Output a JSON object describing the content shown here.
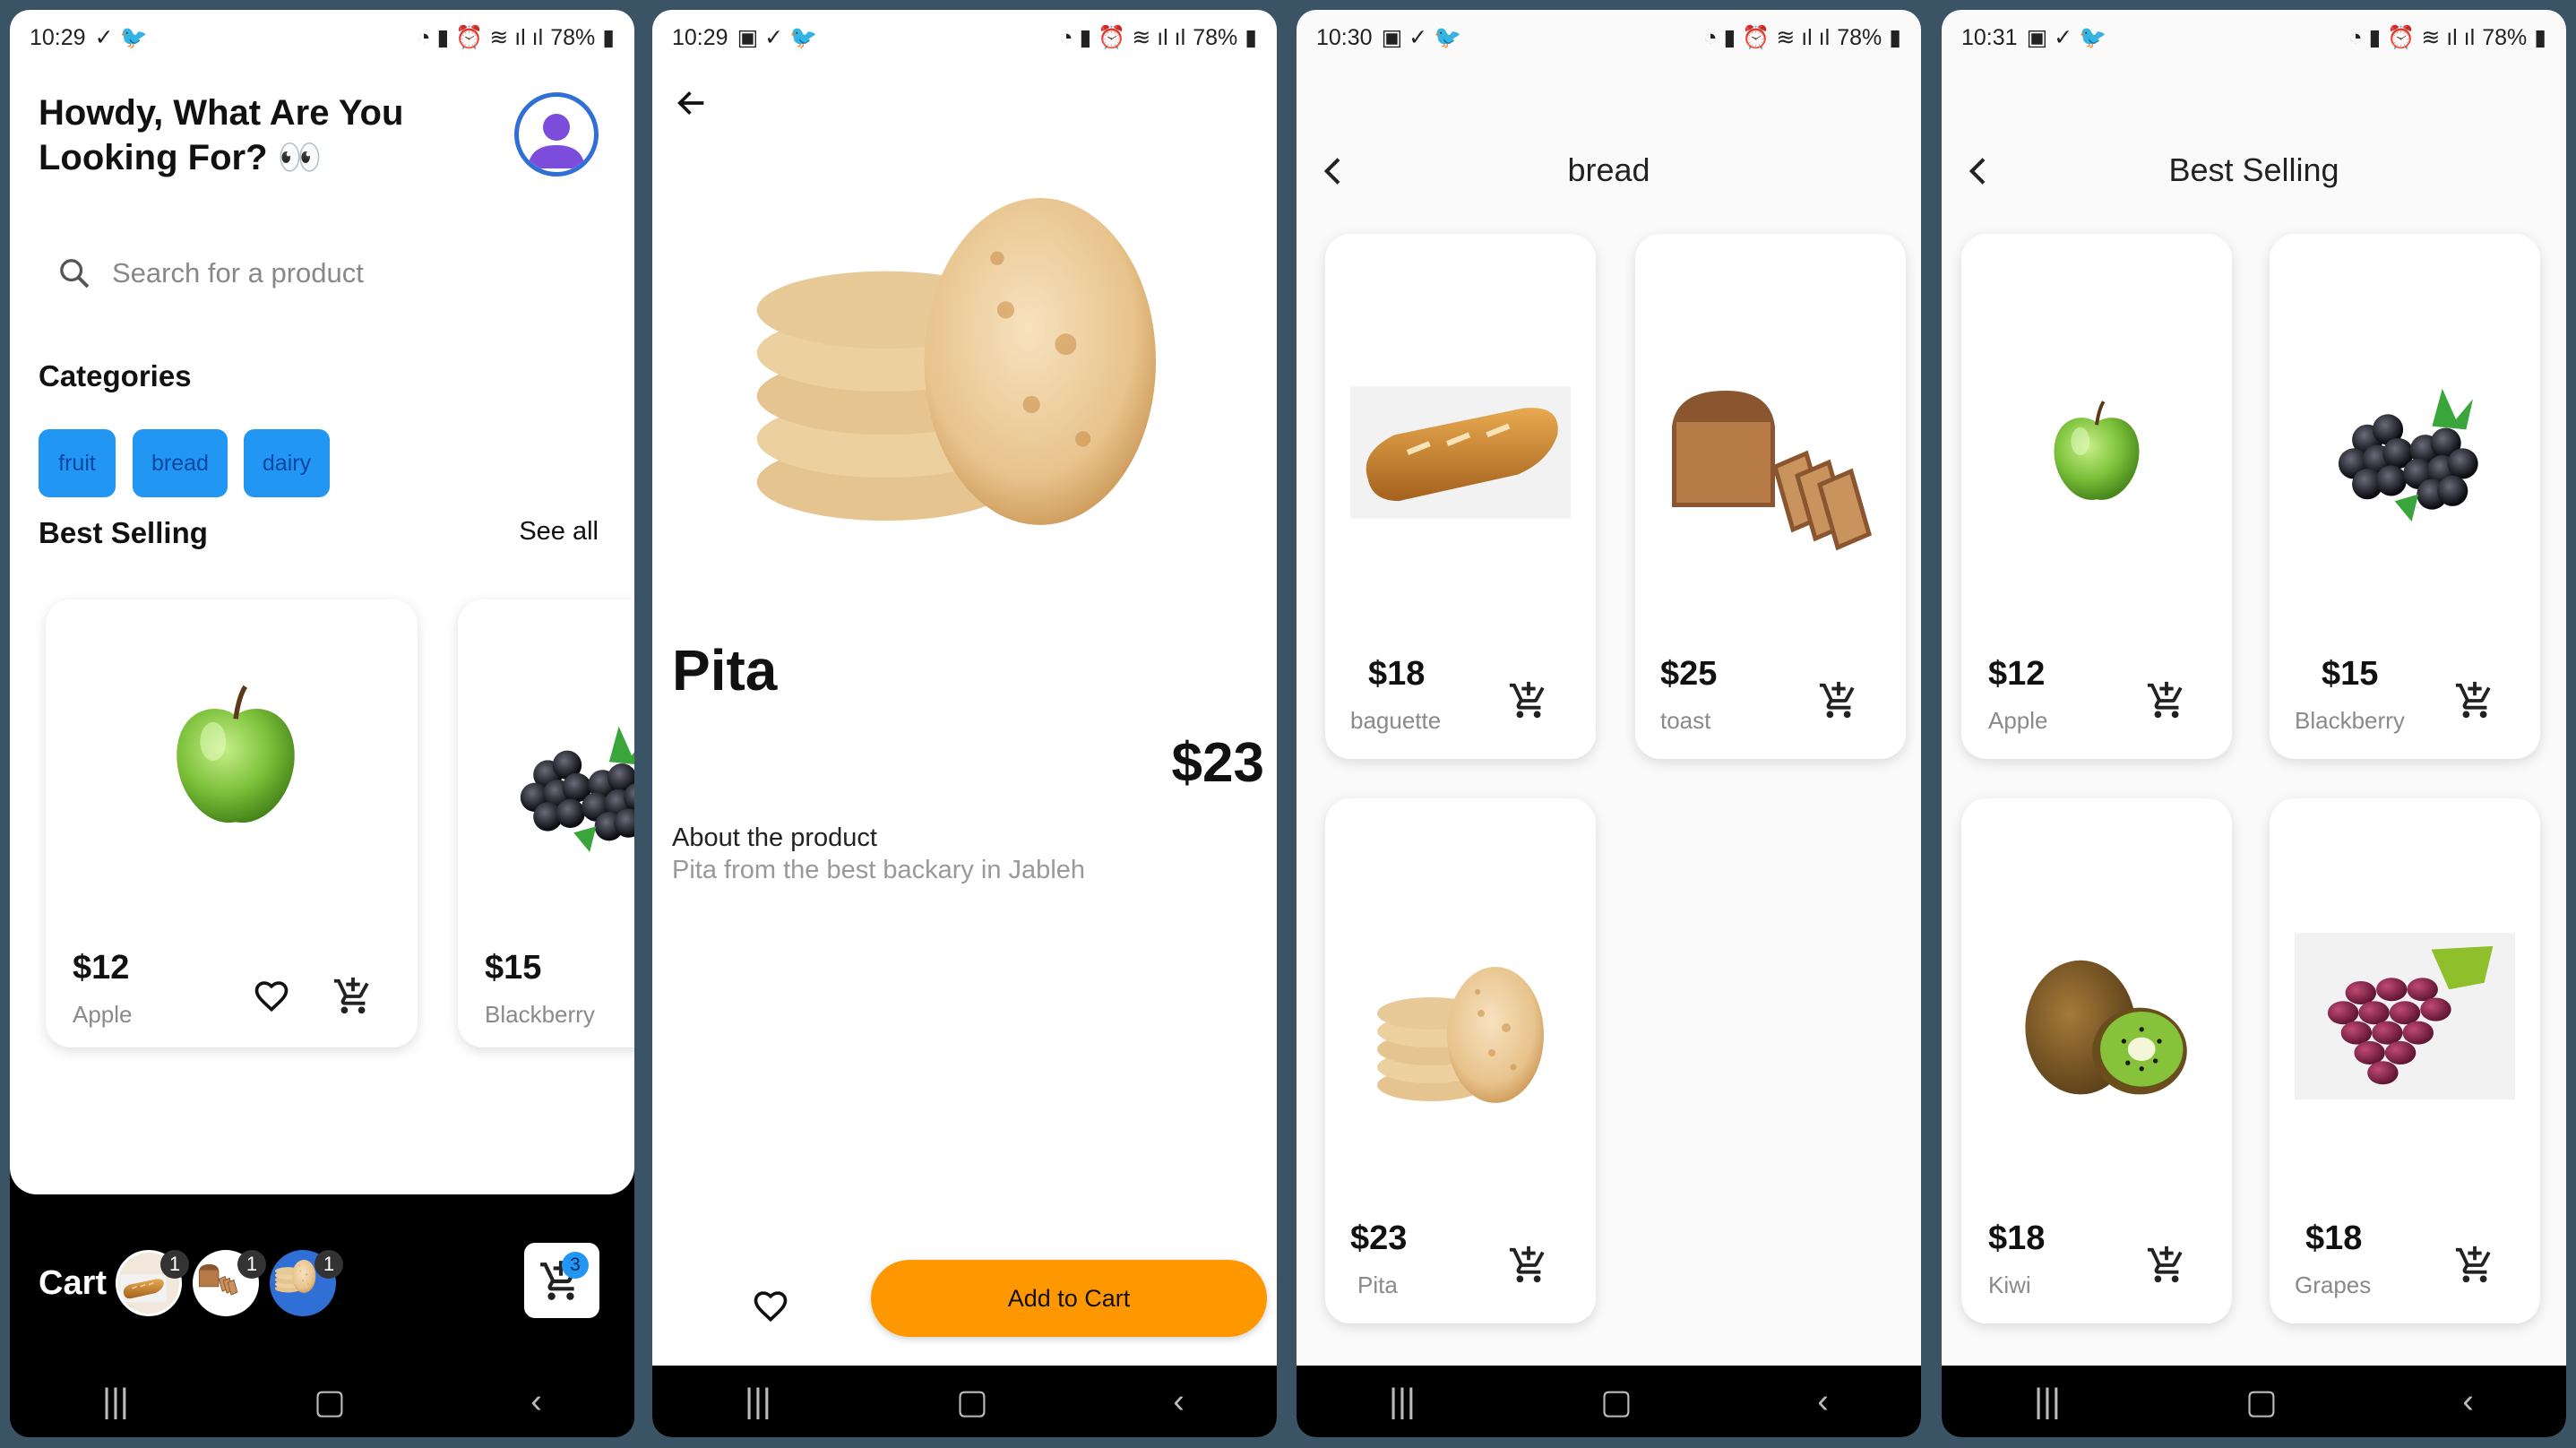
{
  "colors": {
    "accent": "#2196f3",
    "orange": "#ff9800",
    "bg": "#3a5466"
  },
  "status": {
    "battery": "78%",
    "s1_time": "10:29",
    "s2_time": "10:29",
    "s3_time": "10:30",
    "s4_time": "10:31"
  },
  "home": {
    "greeting_line1": "Howdy, What Are You",
    "greeting_line2": "Looking For? 👀",
    "search_placeholder": "Search for a product",
    "categories_title": "Categories",
    "categories": [
      "fruit",
      "bread",
      "dairy"
    ],
    "best_selling_title": "Best Selling",
    "see_all": "See all",
    "products": [
      {
        "price": "$12",
        "name": "Apple"
      },
      {
        "price": "$15",
        "name": "Blackberry"
      }
    ],
    "cart_label": "Cart",
    "cart_badges": [
      "1",
      "1",
      "1"
    ],
    "cart_count": "3"
  },
  "detail": {
    "title": "Pita",
    "price": "$23",
    "about_title": "About the product",
    "about_text": "Pita from the best backary in Jableh",
    "add_to_cart": "Add to Cart"
  },
  "bread": {
    "title": "bread",
    "products": [
      {
        "price": "$18",
        "name": "baguette"
      },
      {
        "price": "$25",
        "name": "toast"
      },
      {
        "price": "$23",
        "name": "Pita"
      }
    ]
  },
  "best": {
    "title": "Best Selling",
    "products": [
      {
        "price": "$12",
        "name": "Apple"
      },
      {
        "price": "$15",
        "name": "Blackberry"
      },
      {
        "price": "$18",
        "name": "Kiwi"
      },
      {
        "price": "$18",
        "name": "Grapes"
      }
    ]
  }
}
